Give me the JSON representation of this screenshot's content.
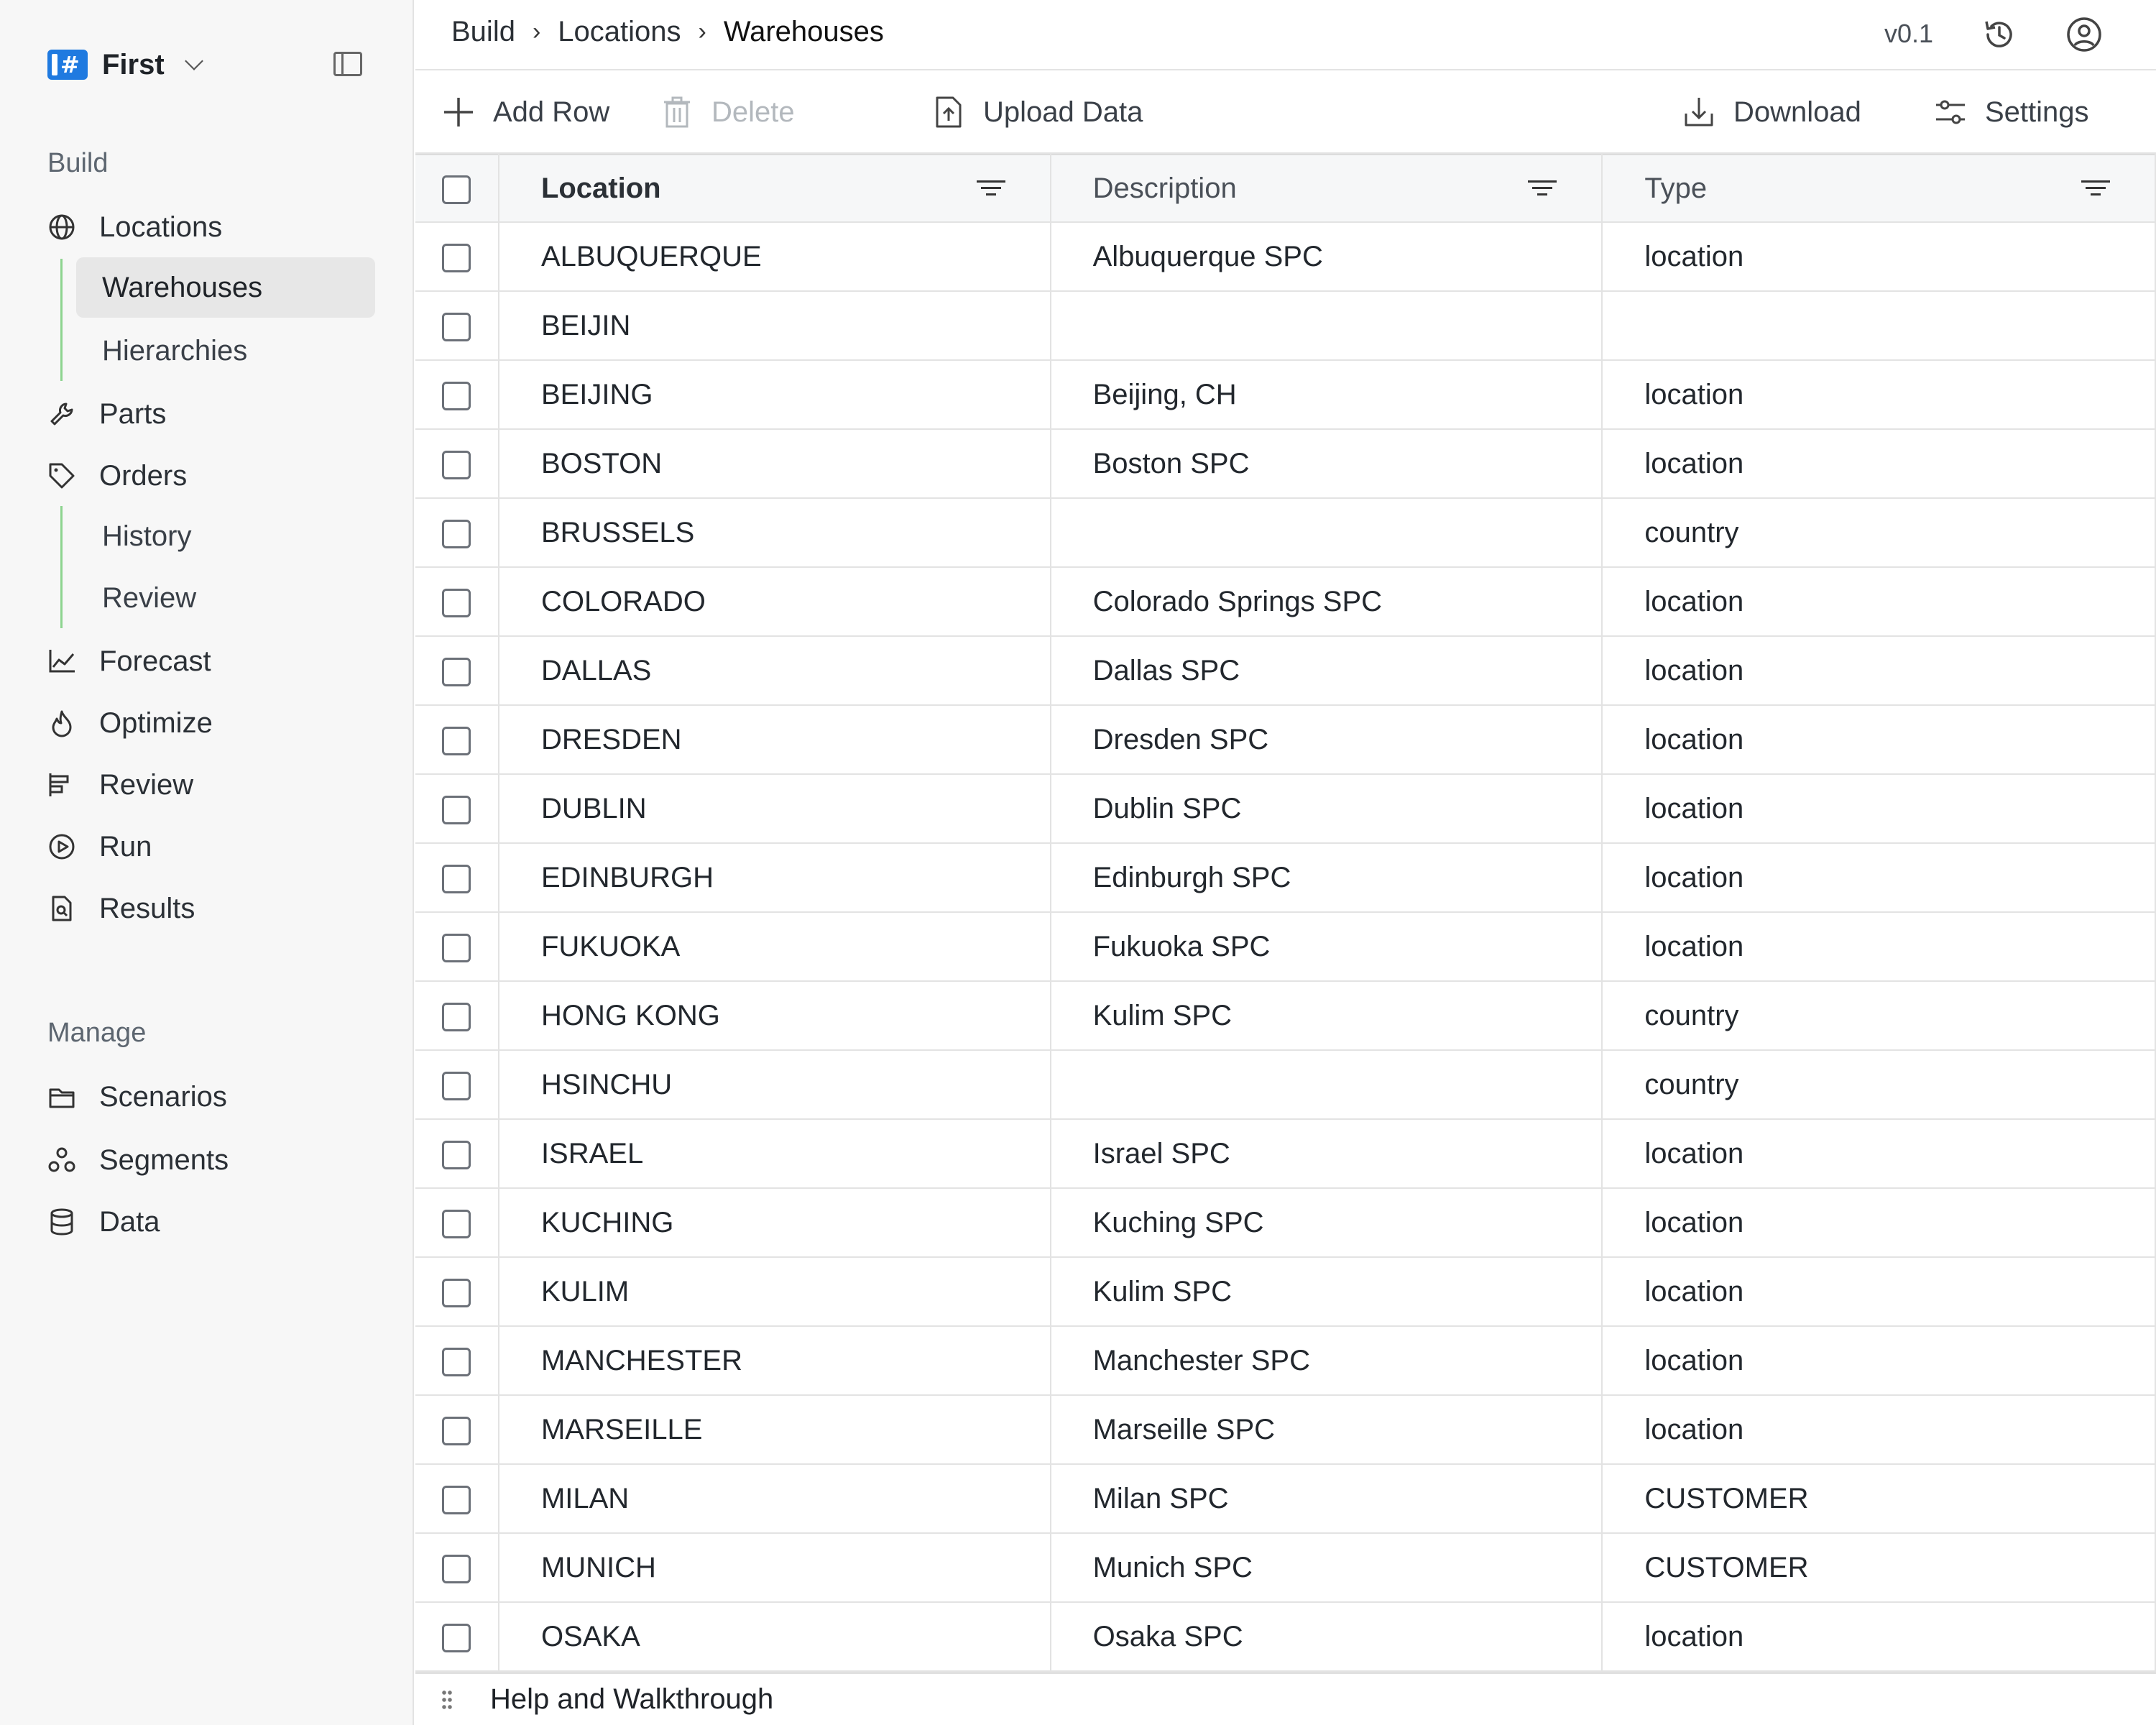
{
  "workspace": {
    "name": "First"
  },
  "sidebar": {
    "build_title": "Build",
    "manage_title": "Manage",
    "build_items": [
      {
        "label": "Locations",
        "icon": "globe-icon"
      },
      {
        "label": "Parts",
        "icon": "wrench-icon"
      },
      {
        "label": "Orders",
        "icon": "tag-icon"
      },
      {
        "label": "Forecast",
        "icon": "line-chart-icon"
      },
      {
        "label": "Optimize",
        "icon": "flame-icon"
      },
      {
        "label": "Review",
        "icon": "gantt-icon"
      },
      {
        "label": "Run",
        "icon": "play-circle-icon"
      },
      {
        "label": "Results",
        "icon": "file-search-icon"
      }
    ],
    "locations_children": [
      "Warehouses",
      "Hierarchies"
    ],
    "orders_children": [
      "History",
      "Review"
    ],
    "manage_items": [
      {
        "label": "Scenarios",
        "icon": "folder-icon"
      },
      {
        "label": "Segments",
        "icon": "segments-icon"
      },
      {
        "label": "Data",
        "icon": "database-icon"
      }
    ]
  },
  "header": {
    "breadcrumb": [
      "Build",
      "Locations",
      "Warehouses"
    ],
    "version": "v0.1"
  },
  "toolbar": {
    "add_row": "Add Row",
    "delete": "Delete",
    "upload": "Upload Data",
    "download": "Download",
    "settings": "Settings"
  },
  "table": {
    "columns": [
      "Location",
      "Description",
      "Type"
    ],
    "rows": [
      [
        "ALBUQUERQUE",
        "Albuquerque SPC",
        "location"
      ],
      [
        "BEIJIN",
        "",
        ""
      ],
      [
        "BEIJING",
        "Beijing, CH",
        "location"
      ],
      [
        "BOSTON",
        "Boston SPC",
        "location"
      ],
      [
        "BRUSSELS",
        "",
        "country"
      ],
      [
        "COLORADO",
        "Colorado Springs SPC",
        "location"
      ],
      [
        "DALLAS",
        "Dallas SPC",
        "location"
      ],
      [
        "DRESDEN",
        "Dresden SPC",
        "location"
      ],
      [
        "DUBLIN",
        "Dublin SPC",
        "location"
      ],
      [
        "EDINBURGH",
        "Edinburgh SPC",
        "location"
      ],
      [
        "FUKUOKA",
        "Fukuoka SPC",
        "location"
      ],
      [
        "HONG KONG",
        "Kulim SPC",
        "country"
      ],
      [
        "HSINCHU",
        "",
        "country"
      ],
      [
        "ISRAEL",
        "Israel SPC",
        "location"
      ],
      [
        "KUCHING",
        "Kuching SPC",
        "location"
      ],
      [
        "KULIM",
        "Kulim SPC",
        "location"
      ],
      [
        "MANCHESTER",
        "Manchester SPC",
        "location"
      ],
      [
        "MARSEILLE",
        "Marseille SPC",
        "location"
      ],
      [
        "MILAN",
        "Milan SPC",
        "CUSTOMER"
      ],
      [
        "MUNICH",
        "Munich SPC",
        "CUSTOMER"
      ],
      [
        "OSAKA",
        "Osaka SPC",
        "location"
      ]
    ]
  },
  "footer": {
    "help": "Help and Walkthrough"
  },
  "colors": {
    "brand": "#1f7ae0",
    "tree_line": "#8dd48f",
    "active_bg": "#e7e7e7"
  }
}
